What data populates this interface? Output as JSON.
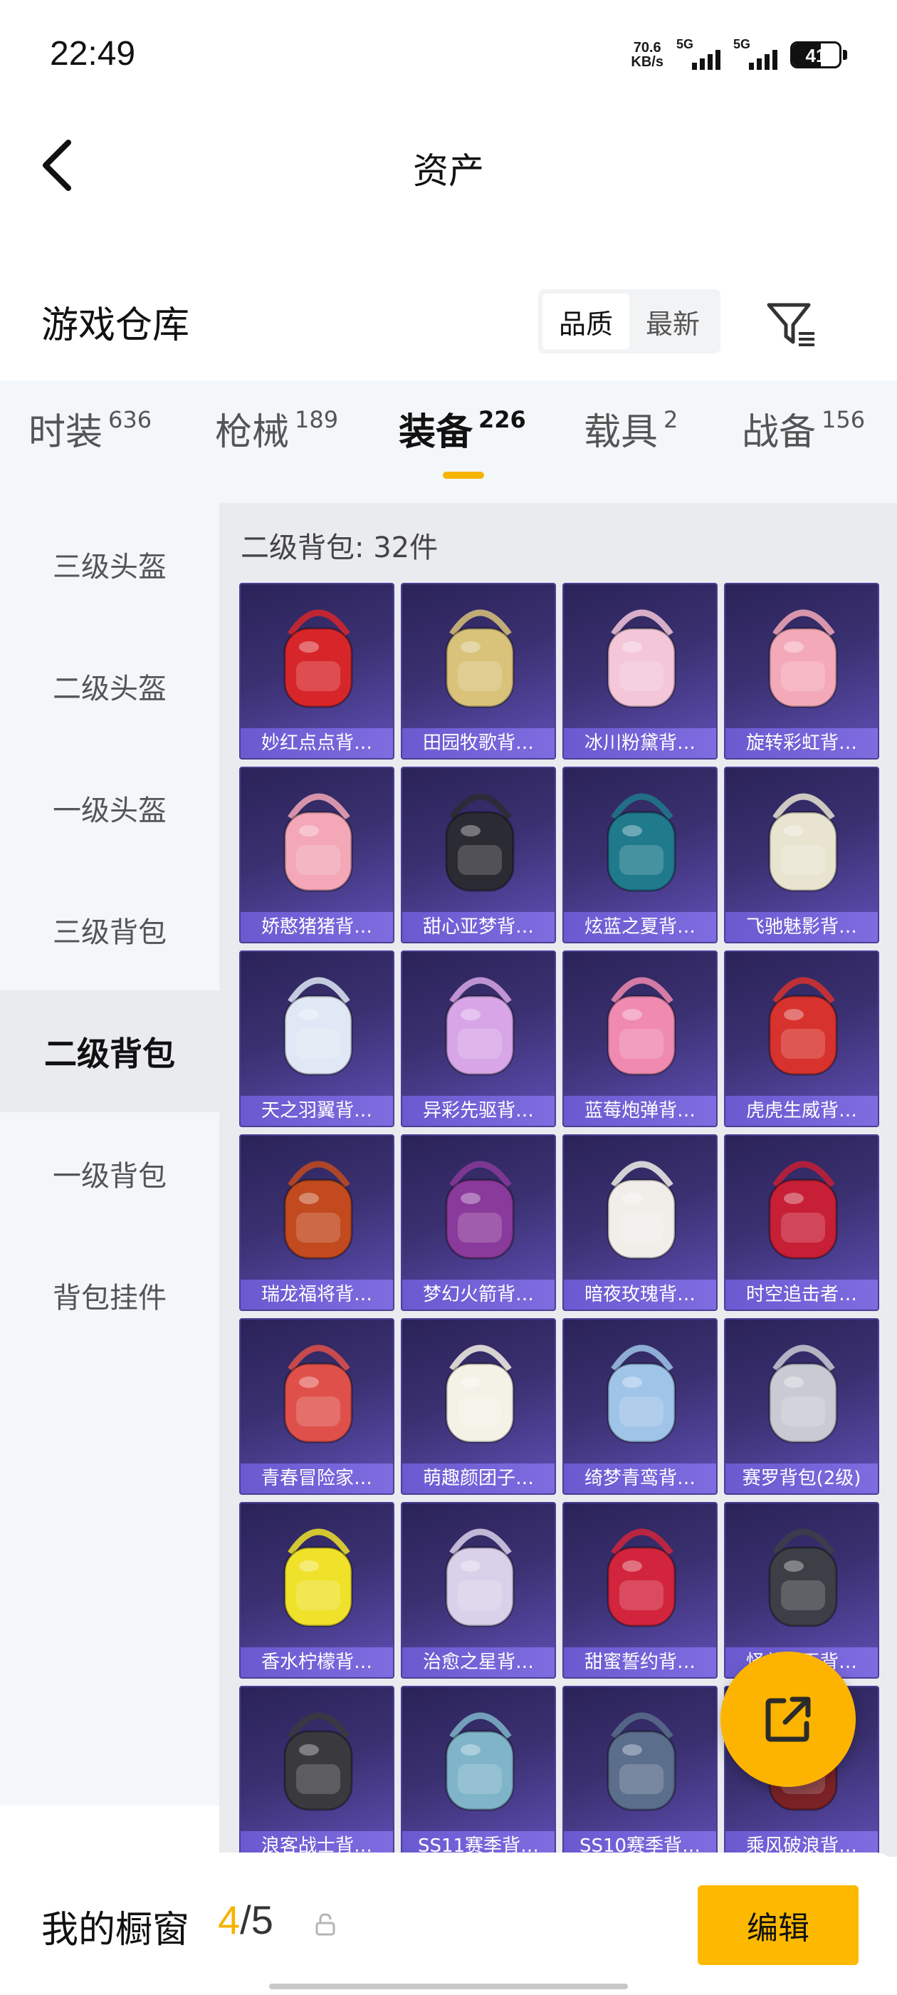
{
  "status_bar": {
    "time": "22:49",
    "speed_value": "70.6",
    "speed_unit": "KB/s",
    "sim1": "5G",
    "sim2": "5G",
    "battery": "41"
  },
  "header": {
    "title": "资产",
    "back_icon": "chevron-left-icon"
  },
  "warehouse": {
    "title": "游戏仓库",
    "sort_options": [
      "品质",
      "最新"
    ],
    "sort_selected": "品质",
    "filter_icon": "filter-icon"
  },
  "tabs": [
    {
      "label": "时装",
      "count": "636"
    },
    {
      "label": "枪械",
      "count": "189"
    },
    {
      "label": "装备",
      "count": "226"
    },
    {
      "label": "载具",
      "count": "2"
    },
    {
      "label": "战备",
      "count": "156"
    }
  ],
  "active_tab": "装备",
  "sidebar": {
    "items": [
      "三级头盔",
      "二级头盔",
      "一级头盔",
      "三级背包",
      "二级背包",
      "一级背包",
      "背包挂件"
    ],
    "active": "二级背包"
  },
  "content": {
    "title": "二级背包: 32件",
    "items": [
      "妙红点点背…",
      "田园牧歌背…",
      "冰川粉黛背…",
      "旋转彩虹背…",
      "娇憨猪猪背…",
      "甜心亚梦背…",
      "炫蓝之夏背…",
      "飞驰魅影背…",
      "天之羽翼背…",
      "异彩先驱背…",
      "蓝莓炮弹背…",
      "虎虎生威背…",
      "瑞龙福将背…",
      "梦幻火箭背…",
      "暗夜玫瑰背…",
      "时空追击者…",
      "青春冒险家…",
      "萌趣颜团子…",
      "绮梦青鸾背…",
      "赛罗背包(2级)",
      "香水柠檬背…",
      "治愈之星背…",
      "甜蜜誓约背…",
      "怪兽之王背…",
      "浪客战士背…",
      "SS11赛季背…",
      "SS10赛季背…",
      "乘风破浪背…"
    ],
    "item_colors": [
      "#d7262a",
      "#d9c27a",
      "#f3c6d8",
      "#f4a9b8",
      "#f3a7b7",
      "#2b2b33",
      "#1f7a8c",
      "#e9e4d0",
      "#dfe8f4",
      "#d8a6e6",
      "#f08ab0",
      "#d8322e",
      "#c24a1e",
      "#8a3a9a",
      "#f1eee9",
      "#c71f35",
      "#e0504a",
      "#f4f1e6",
      "#9fc4e8",
      "#c8cbd4",
      "#f0e22a",
      "#d9d1ea",
      "#d2243c",
      "#3d3f46",
      "#3a3a3e",
      "#7fb4c9",
      "#5b6e8c",
      "#7b2226"
    ]
  },
  "fab": {
    "icon": "share-icon"
  },
  "bottom_bar": {
    "title": "我的橱窗",
    "count_current": "4",
    "count_sep": "/",
    "count_total": "5",
    "lock_icon": "lock-icon",
    "edit_label": "编辑"
  }
}
